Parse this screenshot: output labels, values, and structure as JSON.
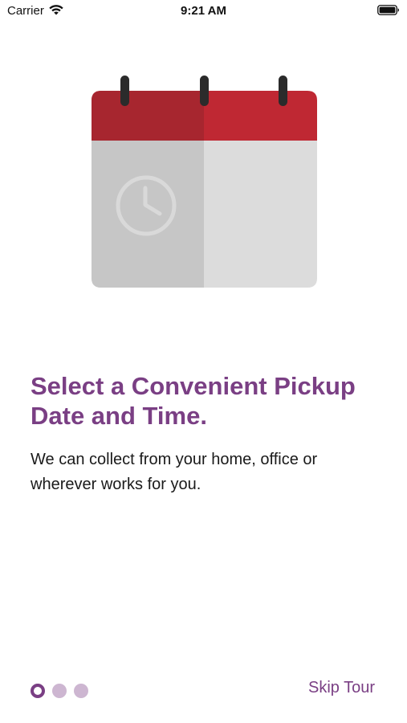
{
  "status_bar": {
    "carrier": "Carrier",
    "time": "9:21 AM",
    "icons": [
      "wifi-icon",
      "battery-icon"
    ]
  },
  "onboarding": {
    "illustration": "calendar-clock-icon",
    "headline": "Select a Convenient Pickup Date and Time.",
    "body": "We can collect from your home, office or wherever works for you.",
    "page_indicator": {
      "total": 3,
      "current": 1
    },
    "skip_label": "Skip Tour"
  },
  "colors": {
    "accent": "#7a3f84",
    "calendar_red": "#c0262f",
    "calendar_gray": "#d6d6d6",
    "inactive_dot": "#cdb6d1"
  }
}
